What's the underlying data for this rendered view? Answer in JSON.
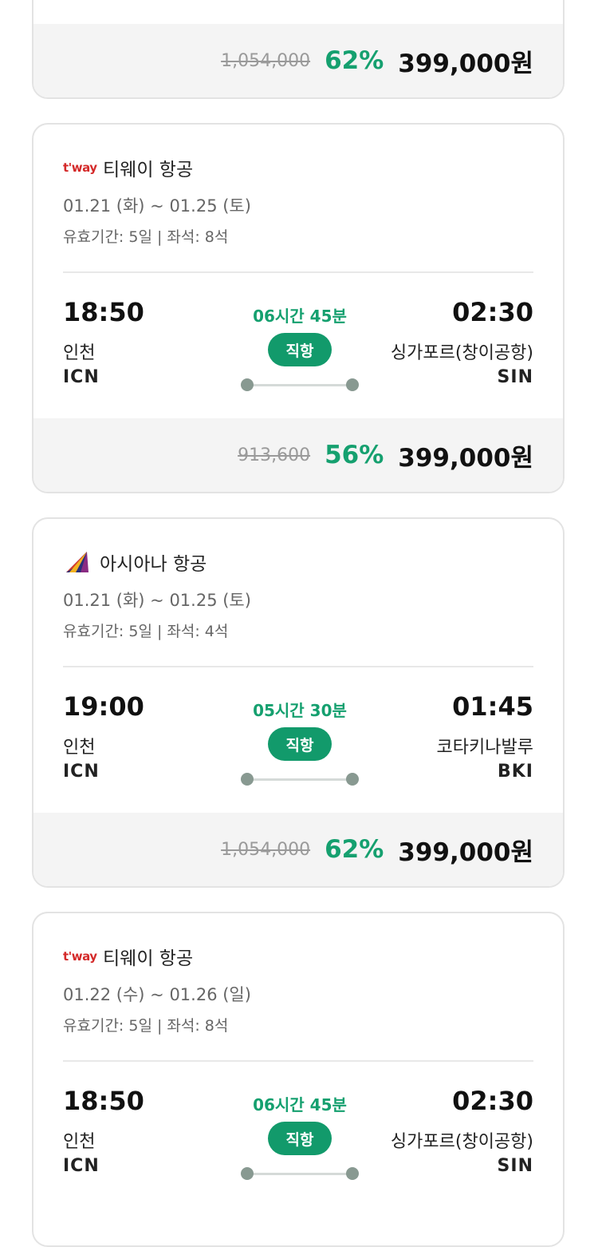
{
  "cards": [
    {
      "price": {
        "original": "1,054,000",
        "discount": "62%",
        "final": "399,000원"
      }
    },
    {
      "airline": {
        "logo_text": "t'way",
        "name": "티웨이 항공"
      },
      "dates": "01.21 (화) ~ 01.25 (토)",
      "meta": "유효기간: 5일 | 좌석: 8석",
      "departure": {
        "time": "18:50",
        "city": "인천",
        "code": "ICN"
      },
      "arrival": {
        "time": "02:30",
        "city": "싱가포르(창이공항)",
        "code": "SIN"
      },
      "duration": "06시간 45분",
      "direct_label": "직항",
      "price": {
        "original": "913,600",
        "discount": "56%",
        "final": "399,000원"
      }
    },
    {
      "airline": {
        "logo_icon": "asiana-logo-icon",
        "name": "아시아나 항공"
      },
      "dates": "01.21 (화) ~ 01.25 (토)",
      "meta": "유효기간: 5일 | 좌석: 4석",
      "departure": {
        "time": "19:00",
        "city": "인천",
        "code": "ICN"
      },
      "arrival": {
        "time": "01:45",
        "city": "코타키나발루",
        "code": "BKI"
      },
      "duration": "05시간 30분",
      "direct_label": "직항",
      "price": {
        "original": "1,054,000",
        "discount": "62%",
        "final": "399,000원"
      }
    },
    {
      "airline": {
        "logo_text": "t'way",
        "name": "티웨이 항공"
      },
      "dates": "01.22 (수) ~ 01.26 (일)",
      "meta": "유효기간: 5일 | 좌석: 8석",
      "departure": {
        "time": "18:50",
        "city": "인천",
        "code": "ICN"
      },
      "arrival": {
        "time": "02:30",
        "city": "싱가포르(창이공항)",
        "code": "SIN"
      },
      "duration": "06시간 45분",
      "direct_label": "직항"
    }
  ],
  "colors": {
    "accent": "#15a06f",
    "badge": "#129a6b",
    "tway": "#d42a2a"
  }
}
